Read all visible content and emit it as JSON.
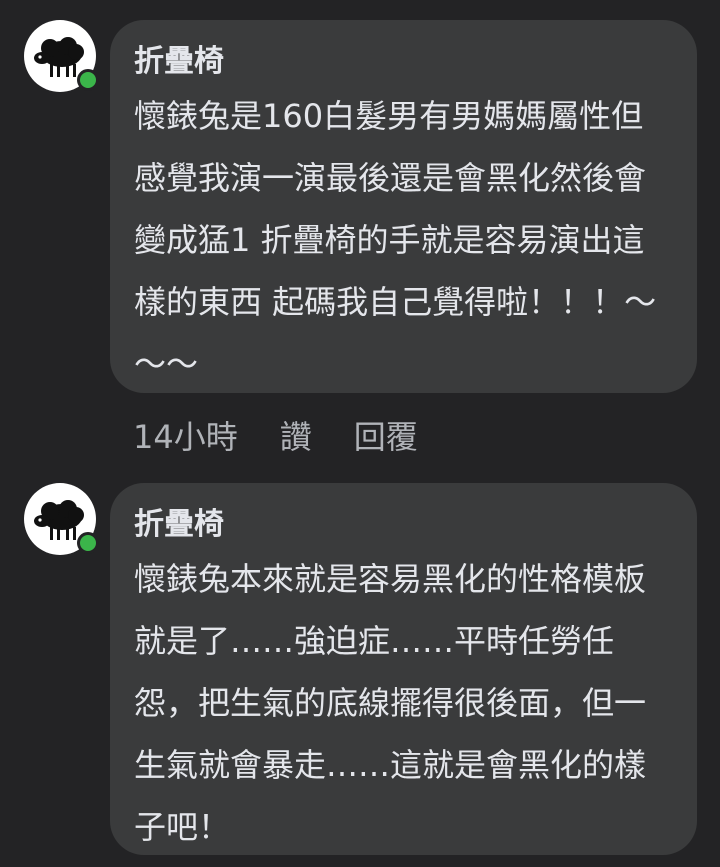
{
  "comments": [
    {
      "author": "折疊椅",
      "text": "懷錶兔是160白髮男有男媽媽屬性但感覺我演一演最後還是會黑化然後會變成猛1 折疊椅的手就是容易演出這樣的東西 起碼我自己覺得啦！！！～～～"
    },
    {
      "author": "折疊椅",
      "text": "懷錶兔本來就是容易黑化的性格模板就是了……強迫症……平時任勞任怨，把生氣的底線擺得很後面，但一生氣就會暴走……這就是會黑化的樣子吧！"
    }
  ],
  "actions": {
    "time": "14小時",
    "like": "讚",
    "reply": "回覆"
  },
  "colors": {
    "background": "#232325",
    "bubble": "#3a3b3c",
    "text": "#e4e6eb",
    "muted": "#b0b3b8",
    "online": "#3bb54a"
  },
  "icons": {
    "avatar": "black-sheep-icon",
    "status": "online-dot"
  }
}
